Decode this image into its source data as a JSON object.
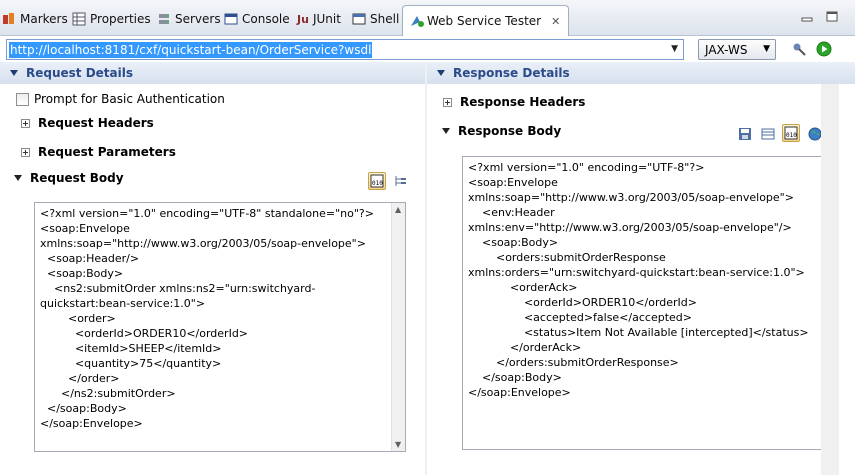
{
  "tabs": [
    {
      "label": "Markers",
      "icon": "markers-icon"
    },
    {
      "label": "Properties",
      "icon": "properties-icon"
    },
    {
      "label": "Servers",
      "icon": "servers-icon"
    },
    {
      "label": "Console",
      "icon": "console-icon"
    },
    {
      "label": "JUnit",
      "icon": "junit-icon",
      "prefix": "Ju"
    },
    {
      "label": "Shell",
      "icon": "shell-icon"
    },
    {
      "label": "Web Service Tester",
      "icon": "web-service-tester-icon",
      "close": "✕"
    }
  ],
  "toolbar": {
    "url": "http://localhost:8181/cxf/quickstart-bean/OrderService?wsdl",
    "protocol": "JAX-WS"
  },
  "request": {
    "title": "Request Details",
    "prompt_auth_label": "Prompt for Basic Authentication",
    "headers_label": "Request Headers",
    "parameters_label": "Request Parameters",
    "body_label": "Request Body",
    "body": "<?xml version=\"1.0\" encoding=\"UTF-8\" standalone=\"no\"?>\n<soap:Envelope\nxmlns:soap=\"http://www.w3.org/2003/05/soap-envelope\">\n  <soap:Header/>\n  <soap:Body>\n    <ns2:submitOrder xmlns:ns2=\"urn:switchyard-\nquickstart:bean-service:1.0\">\n        <order>\n          <orderId>ORDER10</orderId>\n          <itemId>SHEEP</itemId>\n          <quantity>75</quantity>\n        </order>\n      </ns2:submitOrder>\n  </soap:Body>\n</soap:Envelope>"
  },
  "response": {
    "title": "Response Details",
    "headers_label": "Response Headers",
    "body_label": "Response Body",
    "body": "<?xml version=\"1.0\" encoding=\"UTF-8\"?>\n<soap:Envelope\nxmlns:soap=\"http://www.w3.org/2003/05/soap-envelope\">\n    <env:Header\nxmlns:env=\"http://www.w3.org/2003/05/soap-envelope\"/>\n    <soap:Body>\n        <orders:submitOrderResponse\nxmlns:orders=\"urn:switchyard-quickstart:bean-service:1.0\">\n            <orderAck>\n                <orderId>ORDER10</orderId>\n                <accepted>false</accepted>\n                <status>Item Not Available [intercepted]</status>\n            </orderAck>\n        </orders:submitOrderResponse>\n    </soap:Body>\n</soap:Envelope>"
  },
  "colors": {
    "header_text": "#2a4a8a",
    "url_selection": "#3399ff",
    "run_green": "#2aa52a"
  }
}
